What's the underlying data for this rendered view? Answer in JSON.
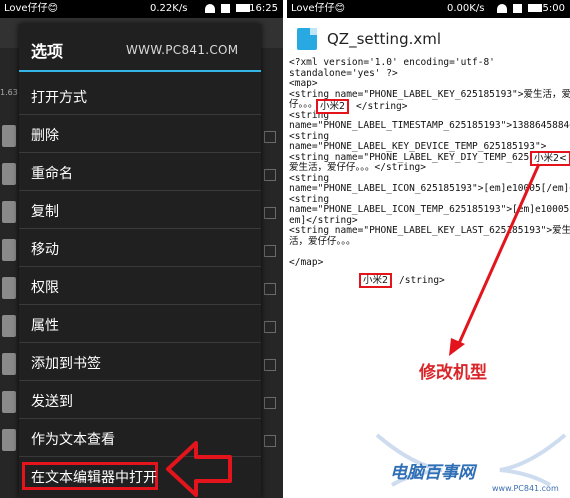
{
  "left_screen": {
    "status_bar": {
      "carrier": "Love仔仔😊",
      "speed": "0.22K/s",
      "time": "16:25"
    },
    "background_header_fragment": "1.63",
    "menu": {
      "title": "选项",
      "items": [
        "打开方式",
        "删除",
        "重命名",
        "复制",
        "移动",
        "权限",
        "属性",
        "添加到书签",
        "发送到",
        "作为文本查看",
        "在文本编辑器中打开"
      ],
      "highlighted_index": 10
    },
    "watermark": "WWW.PC841.COM"
  },
  "right_screen": {
    "status_bar": {
      "carrier": "Love仔仔😊",
      "speed": "0.00K/s",
      "time": "15:00"
    },
    "file_title": "QZ_setting.xml",
    "xml_lines": [
      "<?xml version='1.0' encoding='utf-8'",
      "standalone='yes' ?>",
      "<map>",
      "<string name=\"PHONE_LABEL_KEY_625185193\">爱生活，爱仔",
      "仔。。。",
      "<string",
      "name=\"PHONE_LABEL_TIMESTAMP_625185193\">1388645884<",
      "<string",
      "name=\"PHONE_LABEL_KEY_DEVICE_TEMP_625185193\">",
      "<string name=\"PHONE_LABEL_KEY_DIY_TEMP_625185193\">",
      "爱生活，爱仔仔。。。</string>",
      "<string",
      "name=\"PHONE_LABEL_ICON_625185193\">[em]e10005[/em]</",
      "<string",
      "name=\"PHONE_LABEL_ICON_TEMP_625185193\">[em]e10005[/",
      "em]</string>",
      "<string name=\"PHONE_LABEL_KEY_LAST_625185193\">爱生",
      "活，爱仔仔。。。",
      "</map>"
    ],
    "boxed_values": [
      {
        "text": "小米2"
      },
      {
        "text": "小米2<"
      },
      {
        "text": "小米2"
      }
    ],
    "tail_fragments": [
      "</string>",
      "/string>"
    ],
    "annotation": "修改机型",
    "watermark_logo": "电脑百事网",
    "watermark_url": "www.PC841.com"
  },
  "colors": {
    "highlight_red": "#e3141b",
    "accent_blue": "#33b5e5",
    "annotation_red": "#d9262a"
  }
}
